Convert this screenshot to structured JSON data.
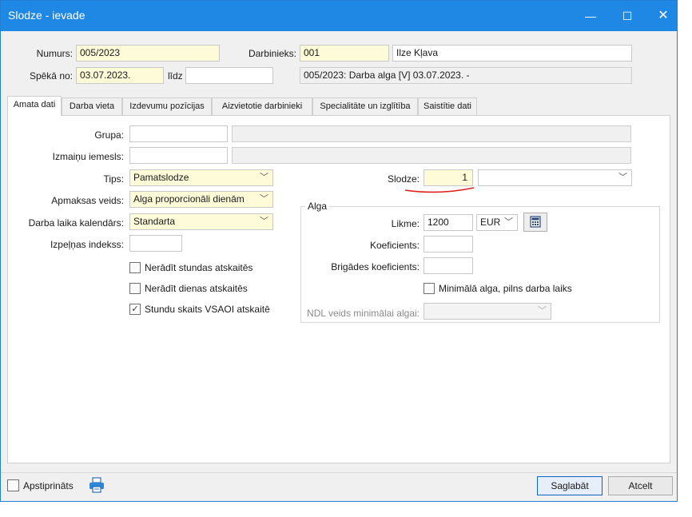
{
  "window": {
    "title": "Slodze - ievade",
    "controls": {
      "minimize": "—",
      "maximize": "☐",
      "close": "✕"
    }
  },
  "header": {
    "numurs_label": "Numurs:",
    "numurs_value": "005/2023",
    "darbinieks_label": "Darbinieks:",
    "darbinieks_code": "001",
    "darbinieks_name": "Ilze Kļava",
    "speka_label": "Spēkā no:",
    "speka_value": "03.07.2023.",
    "lidz_label": "līdz",
    "lidz_value": "",
    "document_info": "005/2023: Darba alga [V] 03.07.2023. -"
  },
  "tabs": [
    {
      "label": "Amata dati",
      "active": true
    },
    {
      "label": "Darba vieta",
      "active": false
    },
    {
      "label": "Izdevumu pozīcijas",
      "active": false
    },
    {
      "label": "Aizvietotie darbinieki",
      "active": false
    },
    {
      "label": "Specialitāte un izglītība",
      "active": false
    },
    {
      "label": "Saistītie dati",
      "active": false
    }
  ],
  "form": {
    "grupa_label": "Grupa:",
    "grupa_value": "",
    "izmainu_label": "Izmaiņu iemesls:",
    "izmainu_value": "",
    "tips_label": "Tips:",
    "tips_value": "Pamatslodze",
    "apmaksas_label": "Apmaksas veids:",
    "apmaksas_value": "Alga proporcionāli dienām",
    "kalendars_label": "Darba laika kalendārs:",
    "kalendars_value": "Standarta",
    "izpelnas_label": "Izpeļņas indekss:",
    "izpelnas_value": "",
    "cb_stundas_label": "Nerādīt stundas atskaitēs",
    "cb_stundas_checked": false,
    "cb_dienas_label": "Nerādīt dienas atskaitēs",
    "cb_dienas_checked": false,
    "cb_vsaoi_label": "Stundu skaits VSAOI atskaitē",
    "cb_vsaoi_checked": true,
    "slodze_label": "Slodze:",
    "slodze_value": "1",
    "slodze_extra_value": ""
  },
  "alga": {
    "group_title": "Alga",
    "likme_label": "Likme:",
    "likme_value": "1200",
    "currency": "EUR",
    "calculator_icon": "calculator-icon",
    "koeficients_label": "Koeficients:",
    "koeficients_value": "",
    "brigades_label": "Brigādes koeficients:",
    "brigades_value": "",
    "min_alga_label": "Minimālā alga, pilns darba laiks",
    "min_alga_checked": false,
    "ndl_label": "NDL veids minimālai algai:",
    "ndl_value": ""
  },
  "footer": {
    "apstiprinats_label": "Apstiprināts",
    "apstiprinats_checked": false,
    "print_icon": "printer-icon",
    "save_label": "Saglabāt",
    "cancel_label": "Atcelt"
  },
  "colors": {
    "titlebar": "#1f87e4",
    "required_field": "#fefcd8",
    "annotation_underline": "#e0201c"
  }
}
